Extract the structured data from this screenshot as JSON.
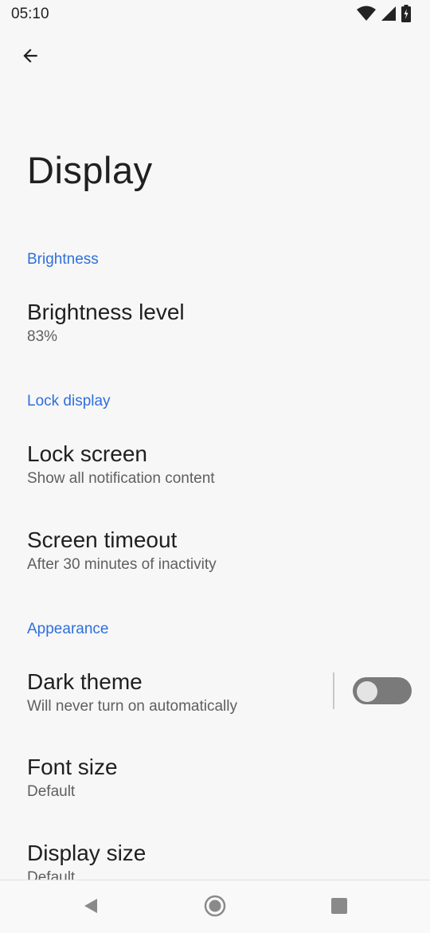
{
  "status_bar": {
    "time": "05:10",
    "icons": [
      "wifi-icon",
      "cellular-signal-icon",
      "battery-icon"
    ]
  },
  "header": {
    "back_icon": "arrow-back-icon",
    "title": "Display"
  },
  "sections": {
    "brightness": {
      "header": "Brightness",
      "brightness_level": {
        "title": "Brightness level",
        "subtitle": "83%"
      }
    },
    "lock_display": {
      "header": "Lock display",
      "lock_screen": {
        "title": "Lock screen",
        "subtitle": "Show all notification content"
      },
      "screen_timeout": {
        "title": "Screen timeout",
        "subtitle": "After 30 minutes of inactivity"
      }
    },
    "appearance": {
      "header": "Appearance",
      "dark_theme": {
        "title": "Dark theme",
        "subtitle": "Will never turn on automatically",
        "enabled": false
      },
      "font_size": {
        "title": "Font size",
        "subtitle": "Default"
      },
      "display_size": {
        "title": "Display size",
        "subtitle": "Default"
      }
    }
  },
  "nav_bar": {
    "icons": [
      "back-triangle-icon",
      "home-circle-icon",
      "recents-square-icon"
    ]
  },
  "colors": {
    "accent": "#2f6fdc",
    "background": "#f7f7f7",
    "toggle_off_track": "#7a7a7a"
  }
}
